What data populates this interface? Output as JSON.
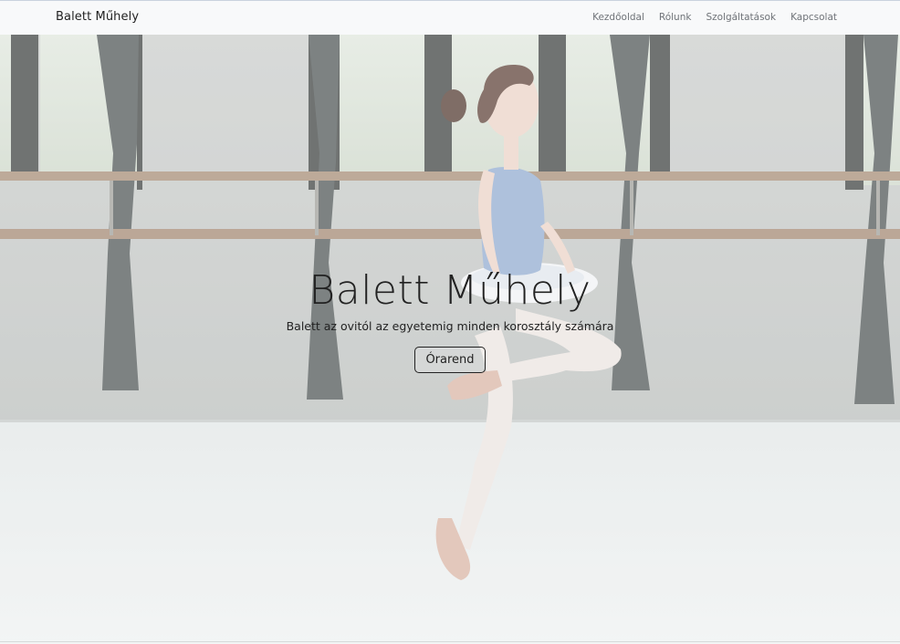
{
  "navbar": {
    "brand": "Balett Műhely",
    "links": [
      {
        "label": "Kezdőoldal"
      },
      {
        "label": "Rólunk"
      },
      {
        "label": "Szolgáltatások"
      },
      {
        "label": "Kapcsolat"
      }
    ]
  },
  "hero": {
    "title": "Balett Műhely",
    "subtitle": "Balett az ovitól az egyetemig minden korosztály számára",
    "button_label": "Órarend"
  },
  "colors": {
    "navbar_bg": "#f8f9fa",
    "text": "#222222",
    "nav_link": "#6f7378"
  }
}
